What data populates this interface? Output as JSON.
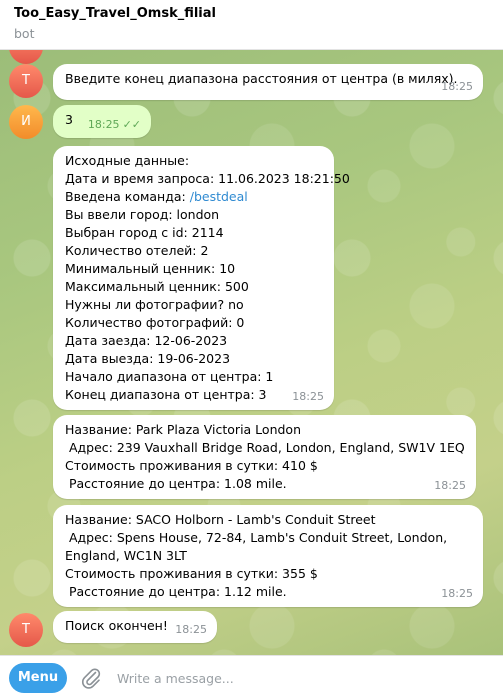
{
  "header": {
    "title": "Too_Easy_Travel_Omsk_filial",
    "subtitle": "bot"
  },
  "avatars": {
    "bot_letter": "T",
    "user_letter": "И"
  },
  "messages": {
    "m1": {
      "text": "Введите конец диапазона расстояния от центра (в милях).",
      "time": "18:25"
    },
    "m2": {
      "text": "3",
      "time": "18:25"
    },
    "m3": {
      "lines": {
        "l0": "Исходные данные:",
        "l1": "Дата и время запроса: 11.06.2023 18:21:50",
        "l2_prefix": "Введена команда: ",
        "l2_link": "/bestdeal",
        "l3": "Вы ввели город: london",
        "l4": "Выбран город с id: 2114",
        "l5": "Количество отелей: 2",
        "l6": "Минимальный ценник: 10",
        "l7": "Максимальный ценник: 500",
        "l8": "Нужны ли фотографии? no",
        "l9": "Количество фотографий: 0",
        "l10": "Дата заезда: 12-06-2023",
        "l11": "Дата выезда: 19-06-2023",
        "l12": "Начало диапазона от центра: 1",
        "l13": "Конец диапазона от центра: 3"
      },
      "time": "18:25"
    },
    "m4": {
      "lines": {
        "l0": "Название: Park Plaza Victoria London",
        "l1": " Адрес: 239 Vauxhall Bridge Road, London, England, SW1V 1EQ",
        "l2": "Стоимость проживания в сутки: 410 $",
        "l3": " Расстояние до центра: 1.08 mile."
      },
      "time": "18:25"
    },
    "m5": {
      "lines": {
        "l0": "Название: SACO Holborn - Lamb's Conduit Street",
        "l1": " Адрес: Spens House, 72-84, Lamb's Conduit Street, London,",
        "l2": "England, WC1N 3LT",
        "l3": "Стоимость проживания в сутки: 355 $",
        "l4": " Расстояние до центра: 1.12 mile."
      },
      "time": "18:25"
    },
    "m6": {
      "text": "Поиск окончен!",
      "time": "18:25"
    }
  },
  "input": {
    "menu_label": "Menu",
    "placeholder": "Write a message...",
    "value": ""
  },
  "colors": {
    "accent": "#3aa0e8",
    "outgoing_bubble": "#e2ffc7",
    "link": "#2f8ad1"
  }
}
